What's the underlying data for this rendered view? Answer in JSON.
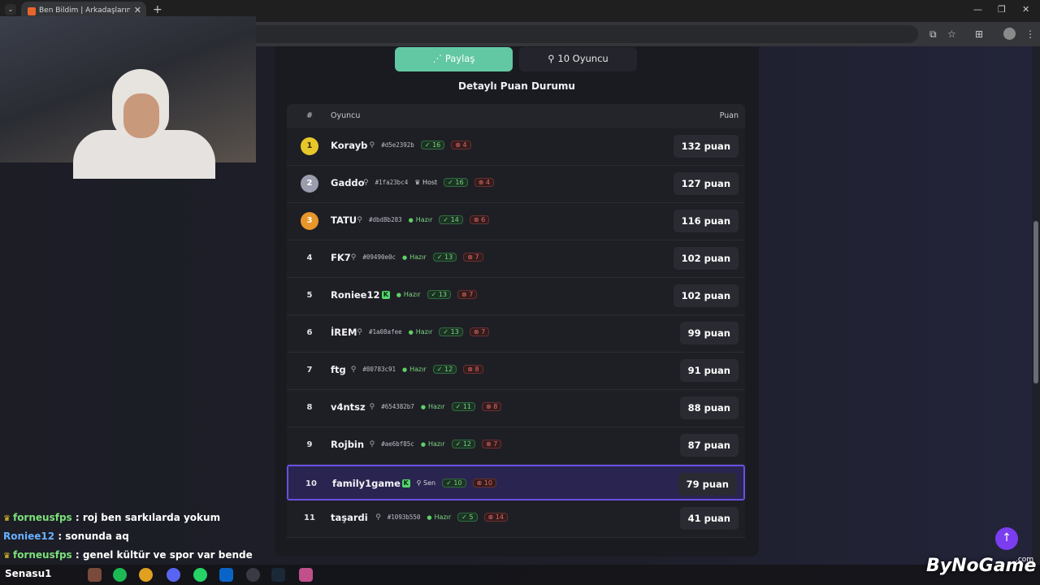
{
  "browser": {
    "tab_title": "Ben Bildim | Arkadaşlarınla Onl...",
    "new_tab": "+",
    "close": "✕",
    "minimize": "—",
    "restore": "❐",
    "window_close": "✕"
  },
  "actions": {
    "share_label": "Paylaş",
    "players_label": "10 Oyuncu"
  },
  "section_title": "Detaylı Puan Durumu",
  "table": {
    "headers": {
      "rank": "#",
      "player": "Oyuncu",
      "score": "Puan"
    },
    "rows": [
      {
        "rank": "1",
        "name": "Korayb",
        "id": "#d5e2392b",
        "tag": "",
        "correct": "16",
        "wrong": "4",
        "score": "132 puan"
      },
      {
        "rank": "2",
        "name": "Gaddo",
        "id": "#1fa23bc4",
        "tag": "Host",
        "correct": "16",
        "wrong": "4",
        "score": "127 puan"
      },
      {
        "rank": "3",
        "name": "TATU",
        "id": "#dbd8b283",
        "tag": "Hazır",
        "correct": "14",
        "wrong": "6",
        "score": "116 puan"
      },
      {
        "rank": "4",
        "name": "FK7",
        "id": "#09490e0c",
        "tag": "Hazır",
        "correct": "13",
        "wrong": "7",
        "score": "102 puan"
      },
      {
        "rank": "5",
        "name": "Roniee12",
        "id": "",
        "tag": "Hazır",
        "correct": "13",
        "wrong": "7",
        "score": "102 puan"
      },
      {
        "rank": "6",
        "name": "İREM",
        "id": "#1a08afee",
        "tag": "Hazır",
        "correct": "13",
        "wrong": "7",
        "score": "99 puan"
      },
      {
        "rank": "7",
        "name": "ftg",
        "id": "#80783c91",
        "tag": "Hazır",
        "correct": "12",
        "wrong": "8",
        "score": "91 puan"
      },
      {
        "rank": "8",
        "name": "v4ntsz",
        "id": "#654382b7",
        "tag": "Hazır",
        "correct": "11",
        "wrong": "8",
        "score": "88 puan"
      },
      {
        "rank": "9",
        "name": "Rojbin",
        "id": "#ae6bf85c",
        "tag": "Hazır",
        "correct": "12",
        "wrong": "7",
        "score": "87 puan"
      },
      {
        "rank": "10",
        "name": "family1game",
        "id": "",
        "tag": "Sen",
        "correct": "10",
        "wrong": "10",
        "score": "79 puan"
      },
      {
        "rank": "11",
        "name": "taşardi",
        "id": "#1093b550",
        "tag": "Hazır",
        "correct": "5",
        "wrong": "14",
        "score": "41 puan"
      }
    ]
  },
  "chat": [
    {
      "user": "forneusfps",
      "message": ": roj ben sarkılarda yokum"
    },
    {
      "user": "Roniee12",
      "message": ": sonunda aq"
    },
    {
      "user": "forneusfps",
      "message": ": genel kültür ve spor var bende"
    }
  ],
  "taskbar": {
    "user_label": "Senasu1"
  },
  "watermark": {
    "brand": "ByNoGame",
    "suffix": ".com"
  },
  "colors": {
    "accent": "#62c8a4",
    "highlight": "#6a4fe0",
    "gold": "#e8c72a"
  }
}
